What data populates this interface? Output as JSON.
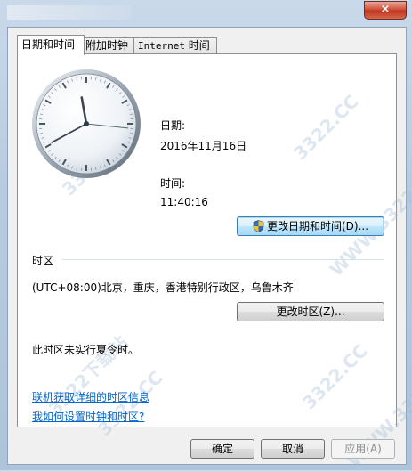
{
  "window": {
    "close_label": "×"
  },
  "tabs": [
    {
      "label": "日期和时间"
    },
    {
      "label": "附加时钟"
    },
    {
      "label_latin": "Internet",
      "label_cn": " 时间"
    }
  ],
  "date_label": "日期:",
  "date_value": "2016年11月16日",
  "time_label": "时间:",
  "time_value": "11:40:16",
  "change_datetime_button": "更改日期和时间(D)...",
  "timezone_heading": "时区",
  "timezone_value": "(UTC+08:00)北京，重庆，香港特别行政区，乌鲁木齐",
  "change_timezone_button": "更改时区(Z)...",
  "dst_notice": "此时区未实行夏令时。",
  "links": {
    "online_info": "联机获取详细的时区信息",
    "how_to": "我如何设置时钟和时区?"
  },
  "buttons": {
    "ok": "确定",
    "cancel": "取消",
    "apply": "应用(A)"
  },
  "watermark": {
    "text1": "3322.CC",
    "text2": "WWW.3322.CC",
    "text3": "3322下载站"
  },
  "clock": {
    "hour": 11,
    "minute": 40,
    "second": 16
  },
  "colors": {
    "link": "#0066cc",
    "close": "#c0361f"
  },
  "icons": {
    "shield": "uac-shield-icon"
  }
}
